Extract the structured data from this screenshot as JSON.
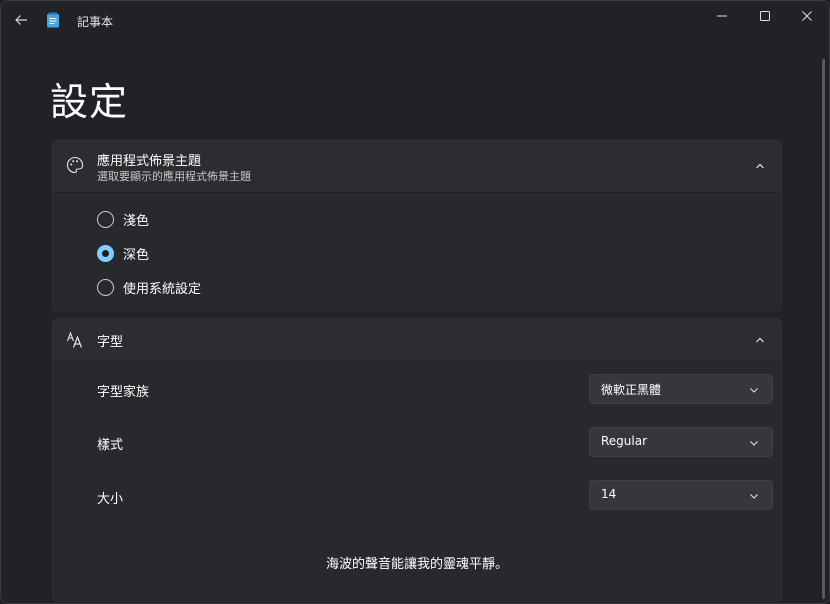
{
  "window": {
    "app_title": "記事本"
  },
  "page": {
    "title": "設定"
  },
  "theme_section": {
    "title": "應用程式佈景主題",
    "subtitle": "選取要顯示的應用程式佈景主題",
    "options": [
      {
        "label": "淺色",
        "selected": false
      },
      {
        "label": "深色",
        "selected": true
      },
      {
        "label": "使用系統設定",
        "selected": false
      }
    ]
  },
  "font_section": {
    "title": "字型",
    "family_label": "字型家族",
    "family_value": "微軟正黑體",
    "style_label": "樣式",
    "style_value": "Regular",
    "size_label": "大小",
    "size_value": "14",
    "preview_text": "海波的聲音能讓我的靈魂平靜。"
  },
  "colors": {
    "accent": "#7dcfff",
    "background": "#202227",
    "card": "#2b2d31"
  }
}
